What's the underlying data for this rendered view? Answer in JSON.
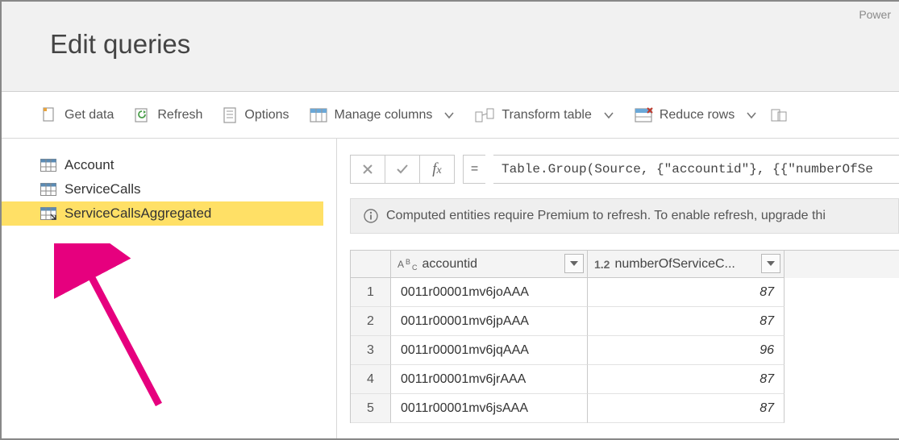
{
  "app_name_partial": "Power",
  "page_title": "Edit queries",
  "toolbar": {
    "get_data": "Get data",
    "refresh": "Refresh",
    "options": "Options",
    "manage_columns": "Manage columns",
    "transform_table": "Transform table",
    "reduce_rows": "Reduce rows"
  },
  "queries": [
    {
      "name": "Account",
      "selected": false,
      "computed": false
    },
    {
      "name": "ServiceCalls",
      "selected": false,
      "computed": false
    },
    {
      "name": "ServiceCallsAggregated",
      "selected": true,
      "computed": true
    }
  ],
  "formula": {
    "eq": "=",
    "text": "Table.Group(Source, {\"accountid\"}, {{\"numberOfSe"
  },
  "info_message": "Computed entities require Premium to refresh. To enable refresh, upgrade thi",
  "columns": [
    {
      "name": "accountid",
      "type_label": "ABC"
    },
    {
      "name": "numberOfServiceC...",
      "type_label": "1.2"
    }
  ],
  "rows": [
    {
      "idx": "1",
      "accountid": "0011r00001mv6joAAA",
      "numberOfServiceC": "87"
    },
    {
      "idx": "2",
      "accountid": "0011r00001mv6jpAAA",
      "numberOfServiceC": "87"
    },
    {
      "idx": "3",
      "accountid": "0011r00001mv6jqAAA",
      "numberOfServiceC": "96"
    },
    {
      "idx": "4",
      "accountid": "0011r00001mv6jrAAA",
      "numberOfServiceC": "87"
    },
    {
      "idx": "5",
      "accountid": "0011r00001mv6jsAAA",
      "numberOfServiceC": "87"
    }
  ],
  "annotation_color": "#e6007e"
}
